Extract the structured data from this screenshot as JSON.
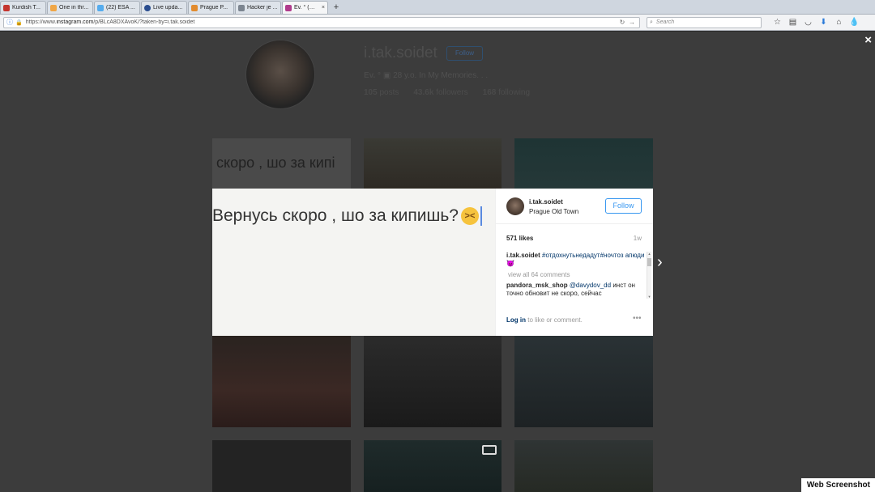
{
  "browser": {
    "tabs": [
      {
        "label": "Kurdish T...",
        "color": "#c4352f"
      },
      {
        "label": "One in thr...",
        "color": "#f0a646"
      },
      {
        "label": "(22) ESA ...",
        "color": "#55acee"
      },
      {
        "label": "Live upda...",
        "color": "#2a4d8f"
      },
      {
        "label": "Prague P...",
        "color": "#e28b2e"
      },
      {
        "label": "Hacker je ...",
        "color": "#7c8590"
      },
      {
        "label": "Ev. ° (@i.t...",
        "color": "#b03b8c"
      }
    ],
    "active_tab_close": "×",
    "new_tab": "+",
    "url_prefix": "https://www.",
    "url_domain": "instagram.com",
    "url_path": "/p/BLcA8DXAvoK/?taken-by=i.tak.soidet",
    "search_placeholder": "Search",
    "toolbar_icons": [
      "star-icon",
      "reading-list-icon",
      "pocket-icon",
      "download-icon",
      "home-icon",
      "sync-icon"
    ]
  },
  "profile": {
    "username": "i.tak.soidet",
    "follow_label": "Follow",
    "bio_name": "Ev. °",
    "bio_text": "28 y.o. In My Memories. . .",
    "posts_count": "105",
    "posts_label": "posts",
    "followers_count": "43.6k",
    "followers_label": "followers",
    "following_count": "168",
    "following_label": "following"
  },
  "grid": {
    "tile1_text": "скоро , шо за кипі"
  },
  "post": {
    "image_text": "Вернусь скоро , шо за кипишь?",
    "emoji": "><",
    "username": "i.tak.soidet",
    "location": "Prague Old Town",
    "follow_label": "Follow",
    "likes": "571 likes",
    "time": "1w",
    "caption_user": "i.tak.soidet",
    "caption_tags": "#отдохнутьнедадут#ночтоз апюди😈",
    "view_all": "view all 64 comments",
    "comment_user": "pandora_msk_shop",
    "comment_mention": "@davydov_dd",
    "comment_text": "инст он точно обновит не скоро, сейчас",
    "login_link": "Log in",
    "login_text": "to like or comment.",
    "more": "•••"
  },
  "overlay": {
    "close": "×",
    "next": "›"
  },
  "watermark": "Web Screenshot"
}
